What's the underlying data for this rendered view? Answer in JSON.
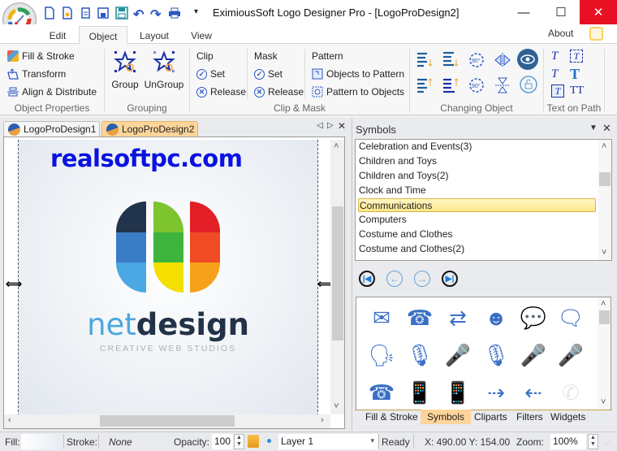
{
  "window": {
    "title": "EximiousSoft Logo Designer Pro - [LogoProDesign2]",
    "minimize": "—",
    "maximize": "☐",
    "close": "✕"
  },
  "quick_access": [
    "new-icon",
    "new-template-icon",
    "copy-icon",
    "save-icon",
    "save-as-icon",
    "undo-icon",
    "redo-icon",
    "print-icon",
    "customize-dropdown-icon"
  ],
  "ribbon_tabs": [
    {
      "label": "Edit",
      "active": false
    },
    {
      "label": "Object",
      "active": true
    },
    {
      "label": "Layout",
      "active": false
    },
    {
      "label": "View",
      "active": false
    }
  ],
  "about": "About",
  "ribbon": {
    "object_properties": {
      "label": "Object Properties",
      "items": [
        "Fill & Stroke",
        "Transform",
        "Align & Distribute"
      ]
    },
    "grouping": {
      "label": "Grouping",
      "group": "Group",
      "ungroup": "UnGroup"
    },
    "clip_mask": {
      "label": "Clip & Mask",
      "clip": {
        "title": "Clip",
        "set": "Set",
        "release": "Release"
      },
      "mask": {
        "title": "Mask",
        "set": "Set",
        "release": "Release"
      },
      "pattern": {
        "title": "Pattern",
        "to_pattern": "Objects to Pattern",
        "to_objects": "Pattern to Objects"
      }
    },
    "changing_object": {
      "label": "Changing Object",
      "icons": [
        "align-bottom-icon",
        "align-top-down-icon",
        "rotate-90-ccw-icon",
        "flip-horizontal-icon",
        "visibility-eye-icon",
        "align-up-icon",
        "align-top-up-icon",
        "rotate-90-cw-icon",
        "flip-vertical-icon",
        "unlock-rotate-icon"
      ]
    },
    "text_on_path": {
      "label": "Text on Path",
      "icons": [
        "put-text-on-path-icon",
        "remove-text-from-path-icon",
        "remove-from-path-icon",
        "text-straighten-icon",
        "text-edit-icon",
        "text-remove-kerning-icon"
      ]
    }
  },
  "documents": {
    "tabs": [
      {
        "label": "LogoProDesign1",
        "active": false
      },
      {
        "label": "LogoProDesign2",
        "active": true
      }
    ],
    "nav_prev": "◁",
    "nav_next": "▷",
    "close": "✕"
  },
  "canvas": {
    "watermark": "realsoftpc.com",
    "logo": {
      "brand_part1": "net",
      "brand_part2": "design",
      "tagline": "CREATIVE WEB STUDIOS",
      "colors": {
        "col1": [
          "#21344c",
          "#3b7cc7",
          "#4aa8e2"
        ],
        "col2": [
          "#7dc42e",
          "#3db53d",
          "#f5df00"
        ],
        "col3": [
          "#e21e26",
          "#ef4b25",
          "#f7a11a"
        ]
      }
    }
  },
  "symbols_panel": {
    "title": "Symbols",
    "categories": [
      {
        "label": "Celebration and Events(3)",
        "selected": false
      },
      {
        "label": "Children and Toys",
        "selected": false
      },
      {
        "label": "Children and Toys(2)",
        "selected": false
      },
      {
        "label": "Clock and Time",
        "selected": false
      },
      {
        "label": "Communications",
        "selected": true
      },
      {
        "label": "Computers",
        "selected": false
      },
      {
        "label": "Costume and Clothes",
        "selected": false
      },
      {
        "label": "Costume and Clothes(2)",
        "selected": false
      }
    ],
    "nav": {
      "first": "|◀",
      "prev": "←",
      "next": "→",
      "last": "▶|"
    },
    "symbols": [
      {
        "name": "email-lightning-icon",
        "glyph": "✉"
      },
      {
        "name": "man-on-phone-icon",
        "glyph": "☎"
      },
      {
        "name": "dotted-arrows-icon",
        "glyph": "⇄"
      },
      {
        "name": "head-profile-icon",
        "glyph": "☻"
      },
      {
        "name": "speech-bubbles-icon",
        "glyph": "💬"
      },
      {
        "name": "speech-bubbles-group-icon",
        "glyph": "🗨"
      },
      {
        "name": "speaking-head-icon",
        "glyph": "🗣"
      },
      {
        "name": "retro-microphone-icon",
        "glyph": "🎙"
      },
      {
        "name": "studio-microphone-icon",
        "glyph": "🎤"
      },
      {
        "name": "podcast-microphone-icon",
        "glyph": "🎙"
      },
      {
        "name": "stand-microphone-icon",
        "glyph": "🎤"
      },
      {
        "name": "handheld-microphone-icon",
        "glyph": "🎤"
      },
      {
        "name": "rotary-phone-icon",
        "glyph": "☎"
      },
      {
        "name": "cell-phone-icon",
        "glyph": "📱"
      },
      {
        "name": "cell-phone-2-icon",
        "glyph": "📱"
      },
      {
        "name": "phones-send-icon",
        "glyph": "⇢"
      },
      {
        "name": "phones-receive-icon",
        "glyph": "⇠"
      },
      {
        "name": "phone-circle-icon",
        "glyph": "✆"
      }
    ],
    "bottom_tabs": [
      {
        "label": "Fill & Stroke",
        "active": false
      },
      {
        "label": "Symbols",
        "active": true
      },
      {
        "label": "Cliparts",
        "active": false
      },
      {
        "label": "Filters",
        "active": false
      },
      {
        "label": "Widgets",
        "active": false
      }
    ]
  },
  "status_bar": {
    "fill_label": "Fill:",
    "stroke_label": "Stroke:",
    "stroke_value": "None",
    "opacity_label": "Opacity:",
    "opacity_value": "100",
    "layer_value": "Layer 1",
    "status": "Ready",
    "coords": "X:  490.00 Y:  154.00",
    "zoom_label": "Zoom:",
    "zoom_value": "100%"
  }
}
